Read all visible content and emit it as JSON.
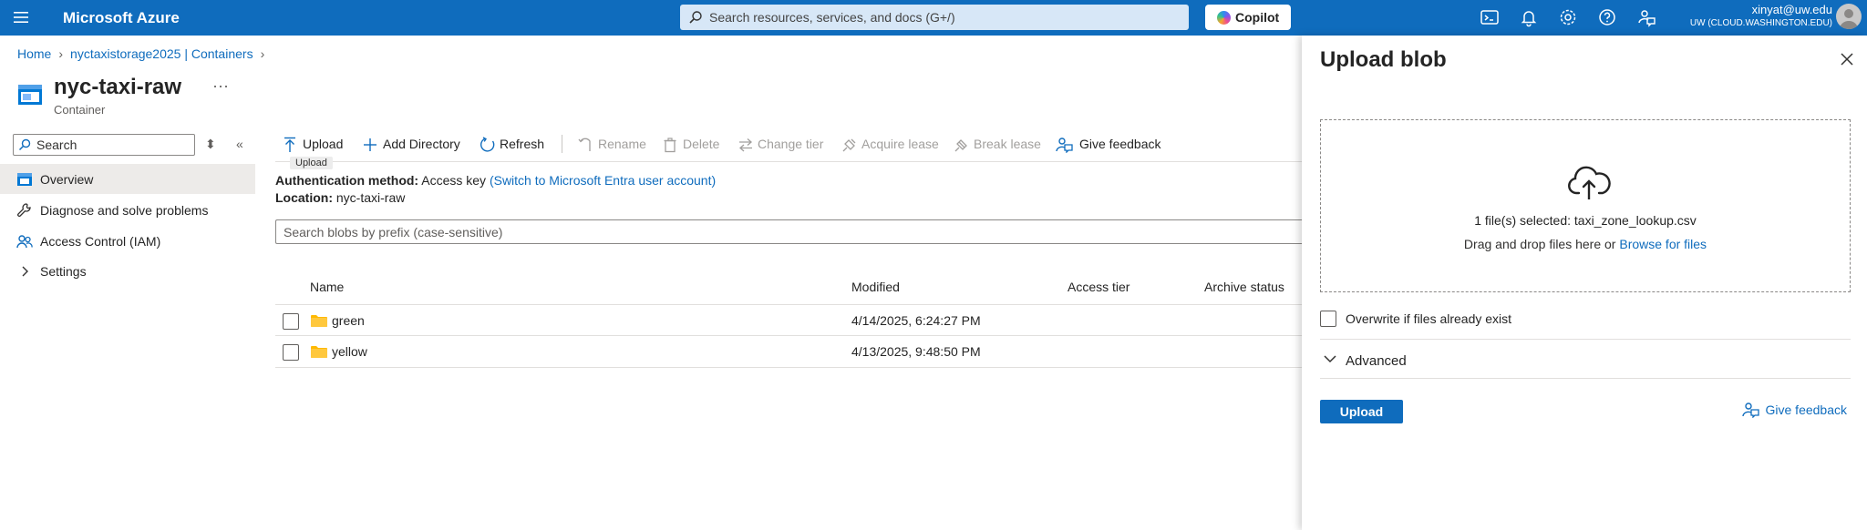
{
  "topbar": {
    "brand": "Microsoft Azure",
    "search_placeholder": "Search resources, services, and docs (G+/)",
    "copilot_label": "Copilot",
    "user_email": "xinyat@uw.edu",
    "user_tenant": "UW (CLOUD.WASHINGTON.EDU)",
    "icons": [
      "cloud-shell-icon",
      "notifications-icon",
      "settings-icon",
      "help-icon",
      "feedback-icon"
    ]
  },
  "breadcrumb": [
    "Home",
    "nyctaxistorage2025 | Containers"
  ],
  "page": {
    "title": "nyc-taxi-raw",
    "subtitle": "Container",
    "more": "···"
  },
  "sidebar": {
    "search_placeholder": "Search",
    "items": [
      {
        "label": "Overview",
        "icon": "overview-icon",
        "active": true
      },
      {
        "label": "Diagnose and solve problems",
        "icon": "wrench-icon"
      },
      {
        "label": "Access Control (IAM)",
        "icon": "people-icon"
      },
      {
        "label": "Settings",
        "icon": "chevron-right-icon"
      }
    ]
  },
  "toolbar": {
    "upload": "Upload",
    "add_directory": "Add Directory",
    "refresh": "Refresh",
    "rename": "Rename",
    "delete": "Delete",
    "change_tier": "Change tier",
    "acquire_lease": "Acquire lease",
    "break_lease": "Break lease",
    "give_feedback": "Give feedback",
    "tooltip": "Upload"
  },
  "info": {
    "auth_label": "Authentication method:",
    "auth_value": "Access key",
    "auth_link": "(Switch to Microsoft Entra user account)",
    "location_label": "Location:",
    "location_value": "nyc-taxi-raw"
  },
  "blob_search": {
    "placeholder": "Search blobs by prefix (case-sensitive)"
  },
  "table": {
    "columns": [
      "Name",
      "Modified",
      "Access tier",
      "Archive status"
    ],
    "rows": [
      {
        "name": "green",
        "modified": "4/14/2025, 6:24:27 PM"
      },
      {
        "name": "yellow",
        "modified": "4/13/2025, 9:48:50 PM"
      }
    ]
  },
  "upload_panel": {
    "title": "Upload blob",
    "selected_text": "1 file(s) selected: taxi_zone_lookup.csv",
    "drag_text": "Drag and drop files here",
    "or_text": "or",
    "browse_link": "Browse for files",
    "overwrite_label": "Overwrite if files already exist",
    "advanced_label": "Advanced",
    "upload_button": "Upload",
    "feedback_link": "Give feedback"
  },
  "colors": {
    "brand_blue": "#0f6cbd",
    "folder_yellow": "#ffb900",
    "nav_active": "#edebe9"
  }
}
